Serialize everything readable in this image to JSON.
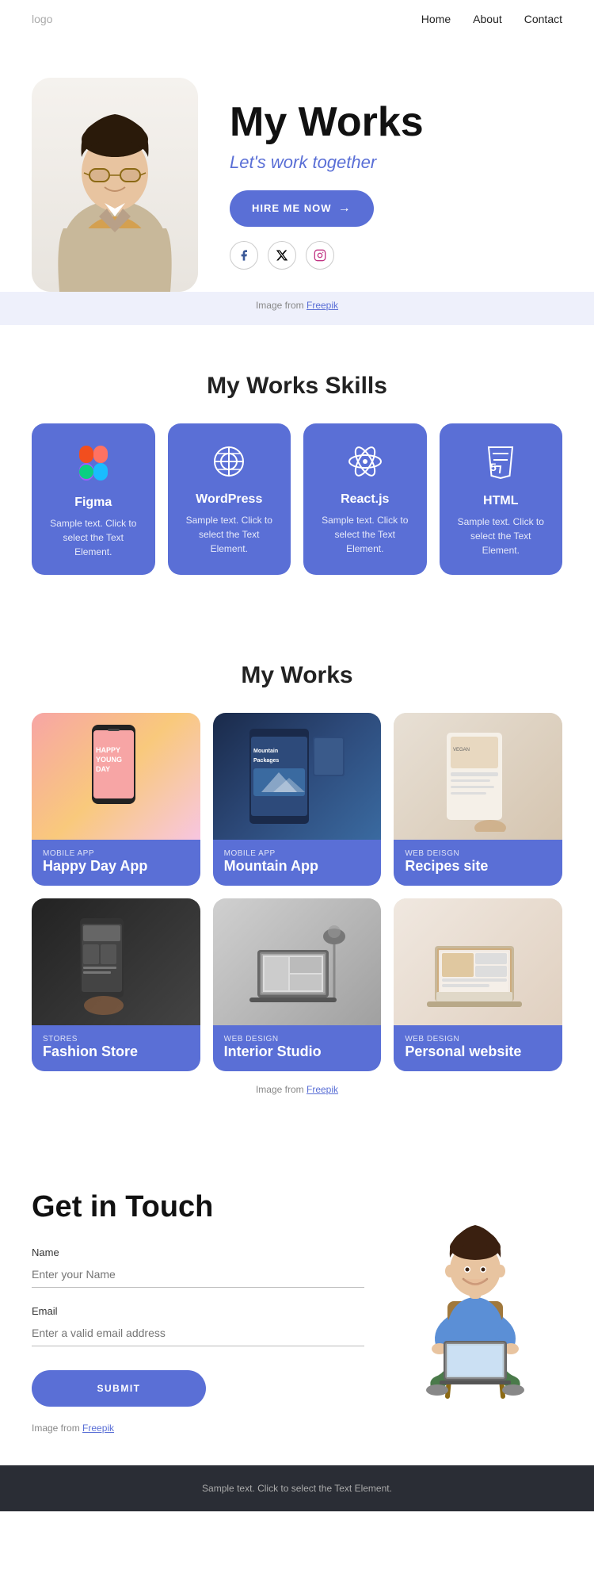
{
  "nav": {
    "logo": "logo",
    "links": [
      "Home",
      "About",
      "Contact"
    ]
  },
  "hero": {
    "title": "My Works",
    "subtitle": "Let's work together",
    "hire_btn": "HIRE ME NOW",
    "social": [
      "facebook",
      "twitter-x",
      "instagram"
    ],
    "image_credit_prefix": "Image from ",
    "image_credit_link": "Freepik"
  },
  "skills": {
    "section_title": "My Works Skills",
    "items": [
      {
        "name": "Figma",
        "desc": "Sample text. Click to select the Text Element.",
        "icon": "figma"
      },
      {
        "name": "WordPress",
        "desc": "Sample text. Click to select the Text Element.",
        "icon": "wordpress"
      },
      {
        "name": "React.js",
        "desc": "Sample text. Click to select the Text Element.",
        "icon": "react"
      },
      {
        "name": "HTML",
        "desc": "Sample text. Click to select the Text Element.",
        "icon": "html"
      }
    ]
  },
  "works": {
    "section_title": "My Works",
    "items": [
      {
        "tag": "MOBILE APP",
        "name": "Happy Day App",
        "bg": "work-bg-1"
      },
      {
        "tag": "MOBILE APP",
        "name": "Mountain App",
        "bg": "work-bg-2"
      },
      {
        "tag": "WEB DEISGN",
        "name": "Recipes site",
        "bg": "work-bg-3"
      },
      {
        "tag": "STORES",
        "name": "Fashion Store",
        "bg": "work-bg-4"
      },
      {
        "tag": "WEB DESIGN",
        "name": "Interior Studio",
        "bg": "work-bg-5"
      },
      {
        "tag": "WEB DESIGN",
        "name": "Personal website",
        "bg": "work-bg-6"
      }
    ],
    "credit_prefix": "Image from ",
    "credit_link": "Freepik"
  },
  "contact": {
    "title": "Get in Touch",
    "name_label": "Name",
    "name_placeholder": "Enter your Name",
    "email_label": "Email",
    "email_placeholder": "Enter a valid email address",
    "submit_btn": "SUBMIT",
    "credit_prefix": "Image from ",
    "credit_link": "Freepik"
  },
  "footer": {
    "text": "Sample text. Click to select the Text Element."
  }
}
